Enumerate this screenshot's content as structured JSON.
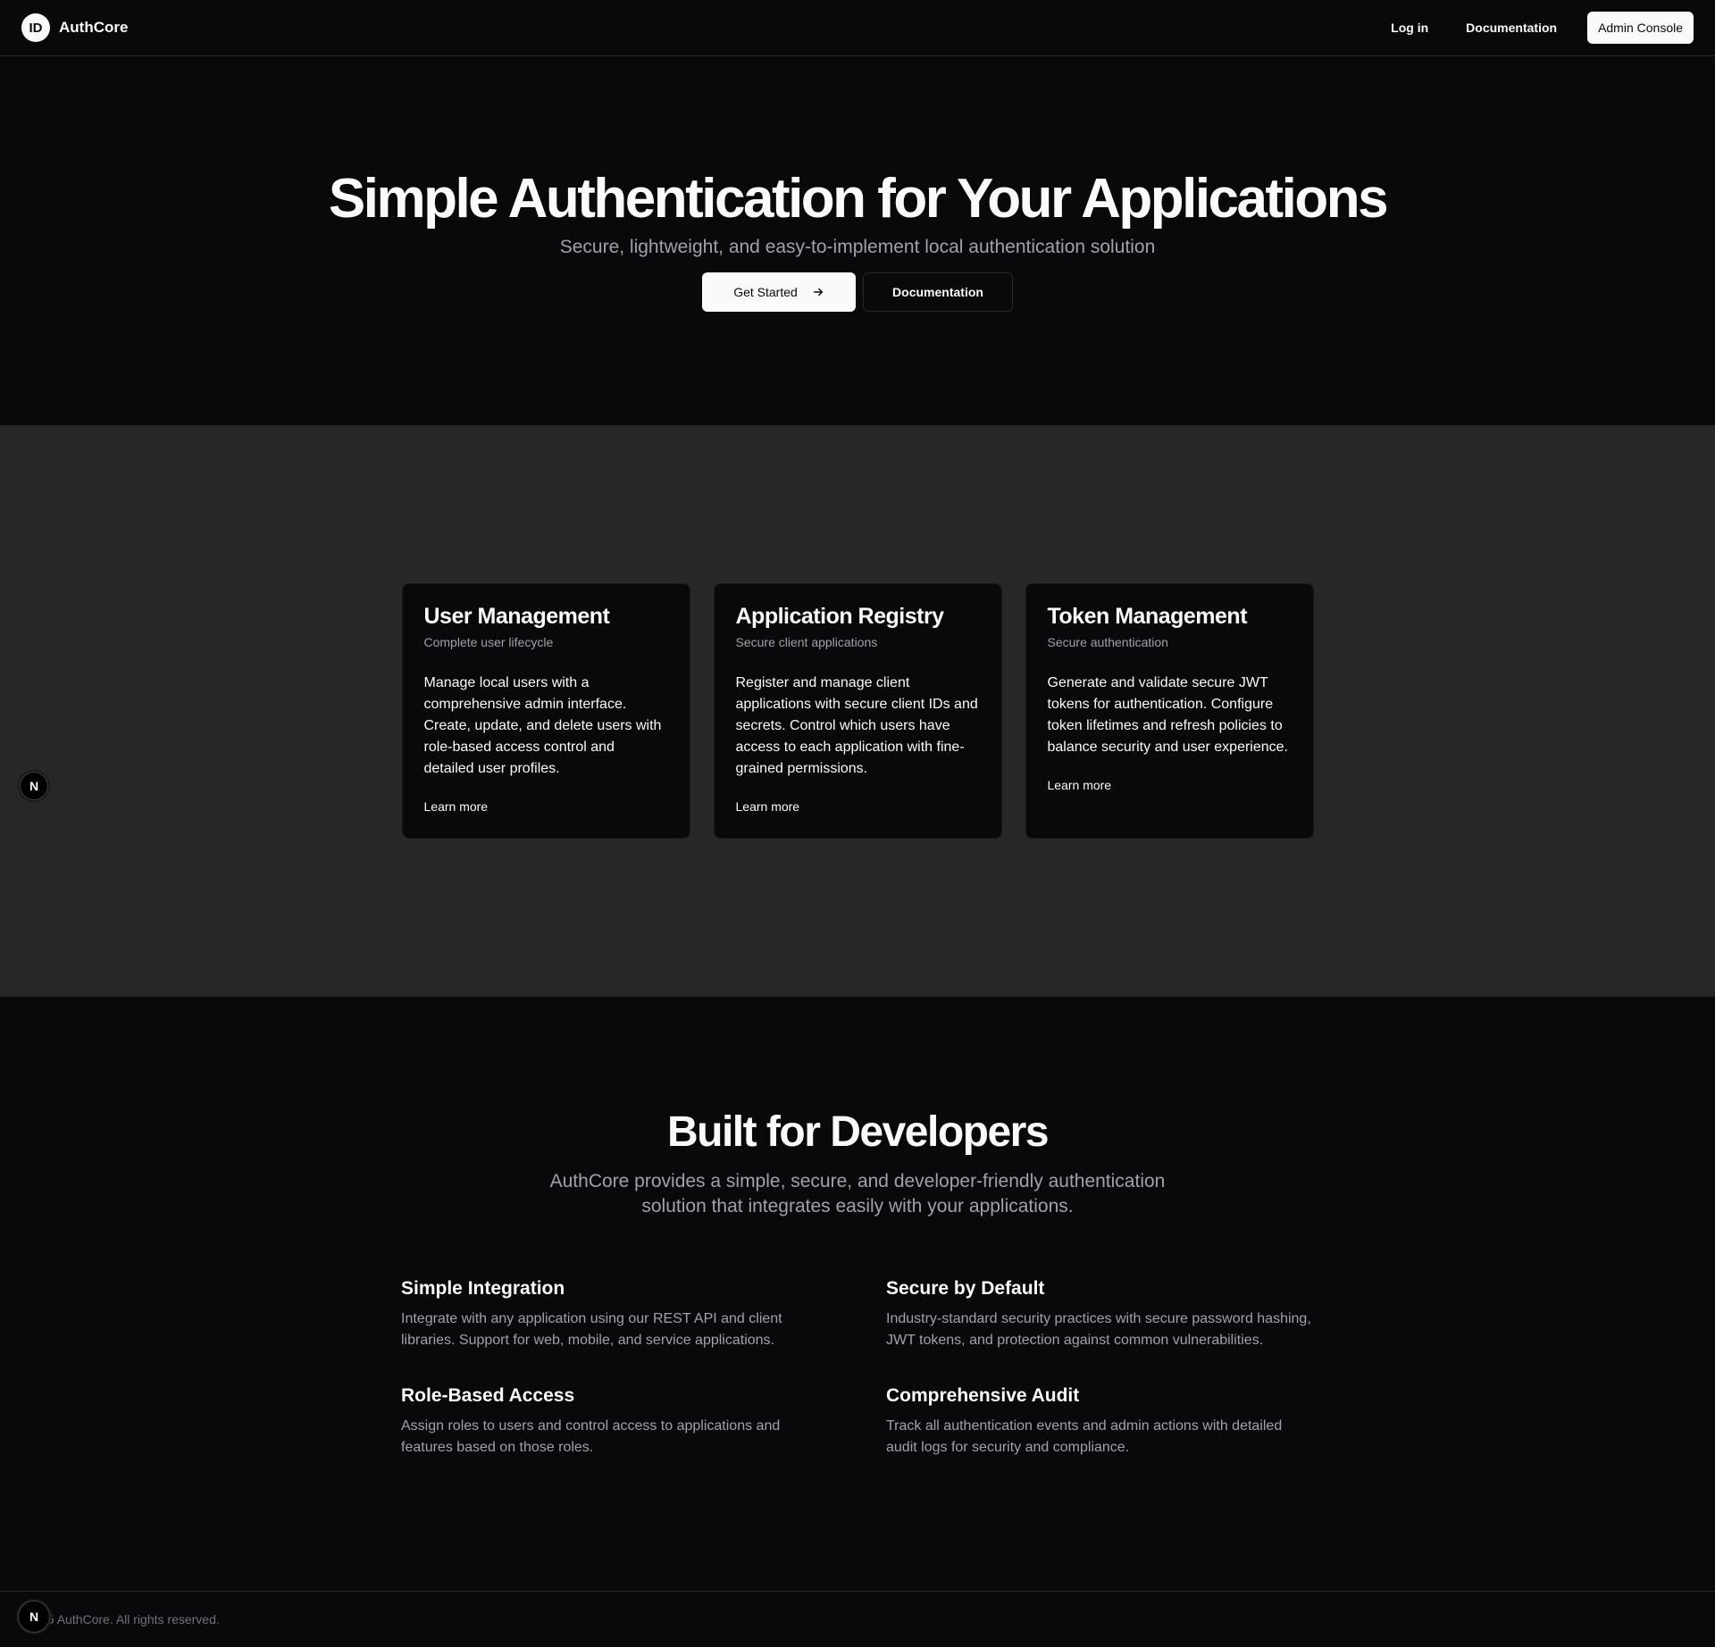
{
  "header": {
    "logo_text": "ID",
    "brand": "AuthCore",
    "nav": {
      "login": "Log in",
      "docs": "Documentation",
      "admin": "Admin Console"
    }
  },
  "hero": {
    "title": "Simple Authentication for Your Applications",
    "subtitle": "Secure, lightweight, and easy-to-implement local authentication solution",
    "primary_cta": "Get Started",
    "secondary_cta": "Documentation"
  },
  "features": {
    "cards": [
      {
        "title": "User Management",
        "subtitle": "Complete user lifecycle",
        "body": "Manage local users with a comprehensive admin interface. Create, update, and delete users with role-based access control and detailed user profiles.",
        "link": "Learn more"
      },
      {
        "title": "Application Registry",
        "subtitle": "Secure client applications",
        "body": "Register and manage client applications with secure client IDs and secrets. Control which users have access to each application with fine-grained permissions.",
        "link": "Learn more"
      },
      {
        "title": "Token Management",
        "subtitle": "Secure authentication",
        "body": "Generate and validate secure JWT tokens for authentication. Configure token lifetimes and refresh policies to balance security and user experience.",
        "link": "Learn more"
      }
    ]
  },
  "developers": {
    "title": "Built for Developers",
    "subtitle": "AuthCore provides a simple, secure, and developer-friendly authentication solution that integrates easily with your applications.",
    "items": [
      {
        "title": "Simple Integration",
        "body": "Integrate with any application using our REST API and client libraries. Support for web, mobile, and service applications."
      },
      {
        "title": "Secure by Default",
        "body": "Industry-standard security practices with secure password hashing, JWT tokens, and protection against common vulnerabilities."
      },
      {
        "title": "Role-Based Access",
        "body": "Assign roles to users and control access to applications and features based on those roles."
      },
      {
        "title": "Comprehensive Audit",
        "body": "Track all authentication events and admin actions with detailed audit logs for security and compliance."
      }
    ]
  },
  "footer": {
    "copyright": "25 AuthCore. All rights reserved."
  },
  "badges": {
    "n_label": "N"
  },
  "colors": {
    "background": "#09090b",
    "surface": "#27272a",
    "foreground": "#fafafa",
    "muted": "#a1a1aa"
  },
  "icons": {
    "cta_arrow": "arrow-right-icon",
    "dev_tools": "nextjs-icon"
  }
}
